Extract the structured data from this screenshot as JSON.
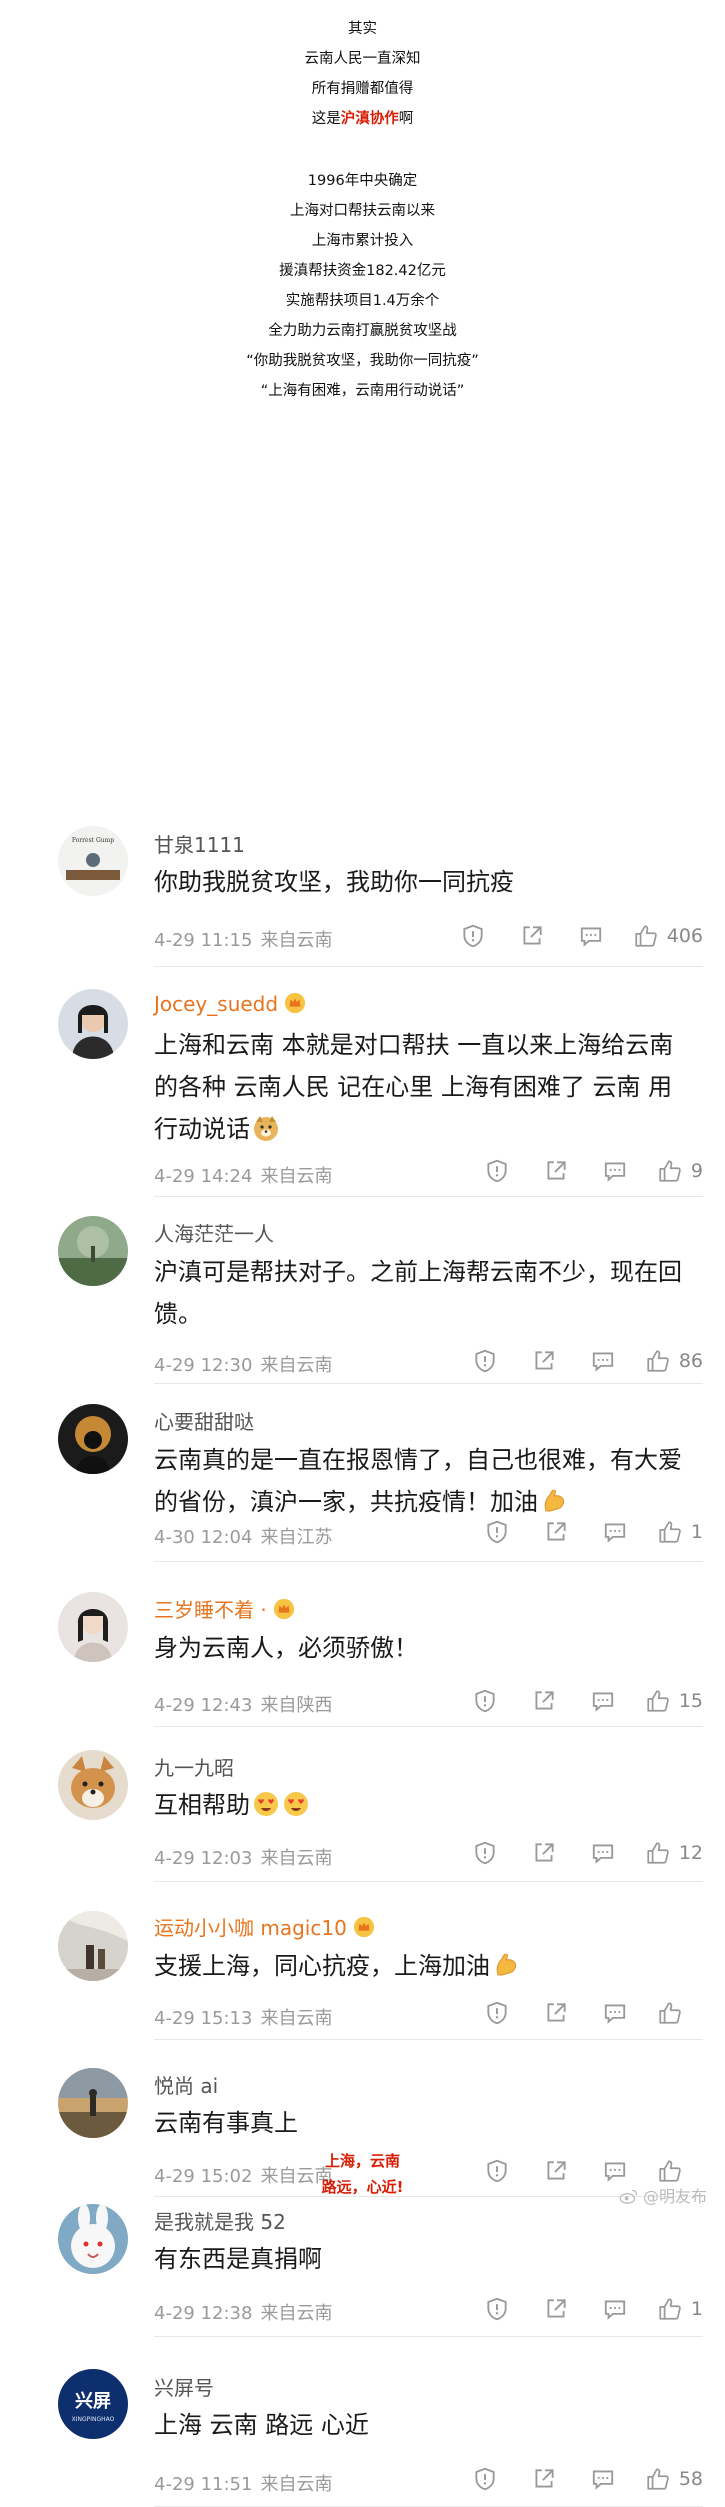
{
  "intro": {
    "lines_top": [
      "其实",
      "云南人民一直深知",
      "所有捐赠都值得"
    ],
    "line4_prefix": "这是",
    "line4_highlight": "沪滇协作",
    "line4_suffix": "啊",
    "lines_bottom": [
      "1996年中央确定",
      "上海对口帮扶云南以来",
      "上海市累计投入",
      "援滇帮扶资金182.42亿元",
      "实施帮扶项目1.4万余个",
      "全力助力云南打赢脱贫攻坚战",
      "“你助我脱贫攻坚，我助你一同抗疫”",
      "“上海有困难，云南用行动说话”"
    ]
  },
  "comments": [
    {
      "name": "甘泉1111",
      "vip": false,
      "text": "你助我脱贫攻坚，我助你一同抗疫",
      "date": "4-29 11:15",
      "location": "来自云南",
      "likes": "406"
    },
    {
      "name": "Jocey_suedd",
      "vip": true,
      "text": "上海和云南 本就是对口帮扶  一直以来上海给云南的各种  云南人民 记在心里 上海有困难了  云南 用行动说话",
      "date": "4-29 14:24",
      "location": "来自云南",
      "likes": "9"
    },
    {
      "name": "人海茫茫一人",
      "vip": false,
      "text": "沪滇可是帮扶对子。之前上海帮云南不少，现在回馈。",
      "date": "4-29 12:30",
      "location": "来自云南",
      "likes": "86"
    },
    {
      "name": "心要甜甜哒",
      "vip": false,
      "text": "云南真的是一直在报恩情了，自己也很难，有大爱的省份，滇沪一家，共抗疫情！加油",
      "date": "4-30 12:04",
      "location": "来自江苏",
      "likes": "1"
    },
    {
      "name": "三岁睡不着 ·",
      "vip": true,
      "text": "身为云南人，必须骄傲！",
      "date": "4-29 12:43",
      "location": "来自陕西",
      "likes": "15"
    },
    {
      "name": "九一九昭",
      "vip": false,
      "text": "互相帮助",
      "date": "4-29 12:03",
      "location": "来自云南",
      "likes": "12"
    },
    {
      "name": "运动小小咖 magic10",
      "vip": true,
      "text": "支援上海，同心抗疫，上海加油",
      "date": "4-29 15:13",
      "location": "来自云南",
      "likes": ""
    },
    {
      "name": "悦尚 ai",
      "vip": false,
      "text": "云南有事真上",
      "date": "4-29 15:02",
      "location": "来自云南",
      "likes": ""
    },
    {
      "name": "是我就是我 52",
      "vip": false,
      "text": "有东西是真捐啊",
      "date": "4-29 12:38",
      "location": "来自云南",
      "likes": "1"
    },
    {
      "name": "兴屏号",
      "vip": false,
      "text": "上海 云南 路远 心近",
      "date": "4-29 11:51",
      "location": "来自云南",
      "likes": "58"
    }
  ],
  "footer": {
    "line1": "上海，云南",
    "line2": "路远，心近!"
  },
  "watermark": "@明友布",
  "colors": {
    "highlight": "#d81e06",
    "vip_name": "#e8741e",
    "meta": "#9a9a9a"
  }
}
